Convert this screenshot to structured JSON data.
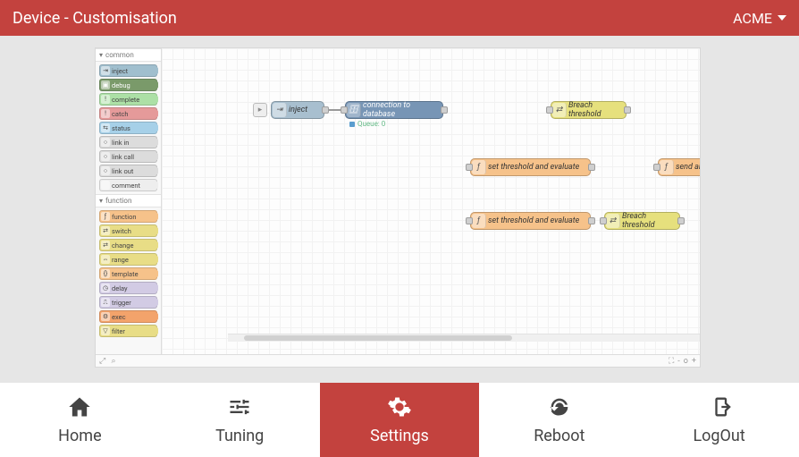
{
  "header": {
    "title": "Device - Customisation",
    "tenant": "ACME"
  },
  "palette": {
    "groups": [
      {
        "name": "common",
        "items": [
          "inject",
          "debug",
          "complete",
          "catch",
          "status",
          "link in",
          "link call",
          "link out",
          "comment"
        ]
      },
      {
        "name": "function",
        "items": [
          "function",
          "switch",
          "change",
          "range",
          "template",
          "delay",
          "trigger",
          "exec",
          "filter"
        ]
      }
    ]
  },
  "canvas": {
    "inject_label": "inject",
    "db_label": "connection to database",
    "queue_label": "Queue: 0",
    "fn1_label": "set threshold and evaluate",
    "fn2_label": "set threshold and evaluate",
    "sw1_label": "Breach threshold",
    "sw2_label": "Breach threshold",
    "alert_label": "send alert"
  },
  "footer": {
    "zoom_out": "-",
    "zoom_reset": "o",
    "zoom_in": "+",
    "search": "⌕",
    "map": "⛶"
  },
  "nav": {
    "home": "Home",
    "tuning": "Tuning",
    "settings": "Settings",
    "reboot": "Reboot",
    "logout": "LogOut"
  }
}
